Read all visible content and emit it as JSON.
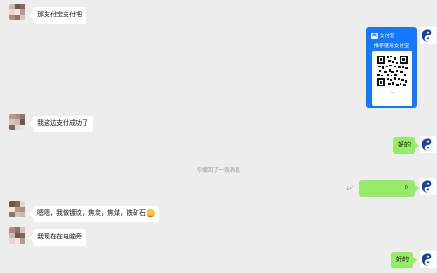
{
  "colors": {
    "background": "#ededed",
    "bubble_sent": "#95ec69",
    "bubble_received": "#ffffff",
    "qr_card": "#1677ff"
  },
  "messages": [
    {
      "side": "left",
      "text": "那支付宝支付吧"
    },
    {
      "side": "right",
      "type": "qr_image",
      "brand": "支付宝",
      "banner": "推荐使用支付宝",
      "caption_line1": "----",
      "caption_line2": "···"
    },
    {
      "side": "left",
      "text": "我这边支付成功了"
    },
    {
      "side": "right",
      "text": "好的"
    },
    {
      "side": "system",
      "text": "你撤回了一条消息"
    },
    {
      "side": "right",
      "type": "voice",
      "duration": "14\"",
      "icon": "voice-wave-icon"
    },
    {
      "side": "left",
      "text": "嗯嗯，我做镀纹，焦炭，焦煤，铁矿石",
      "emoji": "grin-emoji"
    },
    {
      "side": "left",
      "text": "我现在在电脑旁"
    },
    {
      "side": "right",
      "text": "好的"
    }
  ],
  "avatars": {
    "left": "mosaic-avatar",
    "right": "yin-yang-avatar"
  }
}
